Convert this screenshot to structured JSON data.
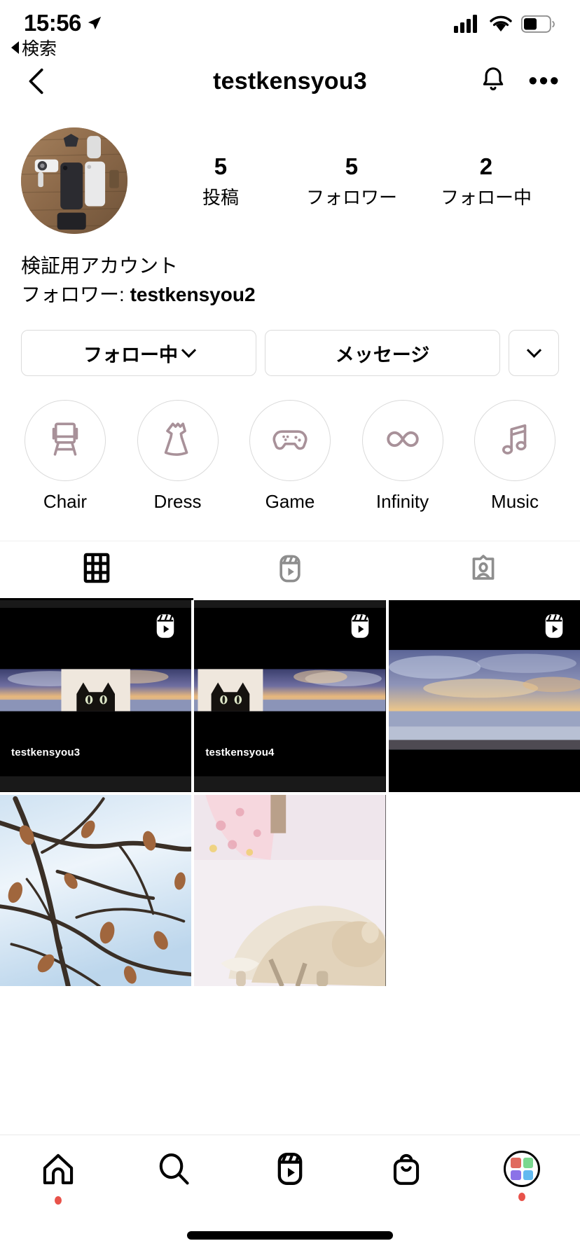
{
  "status_bar": {
    "time": "15:56",
    "location_icon": "location-arrow-icon",
    "back_label": "検索",
    "signal_icon": "cellular-signal-icon",
    "wifi_icon": "wifi-icon",
    "battery_icon": "battery-icon"
  },
  "nav": {
    "back_icon": "chevron-left-icon",
    "title": "testkensyou3",
    "bell_icon": "bell-icon",
    "more_label": "•••"
  },
  "profile": {
    "avatar_icon": "profile-avatar-desk-flatlay",
    "stats": [
      {
        "value": "5",
        "label": "投稿",
        "name": "posts"
      },
      {
        "value": "5",
        "label": "フォロワー",
        "name": "followers"
      },
      {
        "value": "2",
        "label": "フォロー中",
        "name": "following"
      }
    ],
    "bio_name": "検証用アカウント",
    "bio_prefix": "フォロワー: ",
    "bio_username": "testkensyou2"
  },
  "actions": {
    "follow_label": "フォロー中",
    "message_label": "メッセージ",
    "more_icon": "chevron-down-icon"
  },
  "highlights": [
    {
      "label": "Chair",
      "icon": "chair-icon"
    },
    {
      "label": "Dress",
      "icon": "dress-icon"
    },
    {
      "label": "Game",
      "icon": "gamepad-icon"
    },
    {
      "label": "Infinity",
      "icon": "infinity-icon"
    },
    {
      "label": "Music",
      "icon": "music-note-icon"
    }
  ],
  "tabs": [
    {
      "name": "grid",
      "icon": "grid-icon",
      "active": true
    },
    {
      "name": "reels",
      "icon": "reels-icon",
      "active": false
    },
    {
      "name": "tagged",
      "icon": "tagged-icon",
      "active": false
    }
  ],
  "posts": [
    {
      "type": "reel",
      "badge": "reels-icon",
      "overlay_user": "testkensyou3",
      "art": "sunset-sea-cat"
    },
    {
      "type": "reel",
      "badge": "reels-icon",
      "overlay_user": "testkensyou4",
      "art": "cat-sunset-sea"
    },
    {
      "type": "reel",
      "badge": "reels-icon",
      "overlay_user": "",
      "art": "sunset-sea"
    },
    {
      "type": "photo",
      "badge": "",
      "overlay_user": "",
      "art": "winter-branches"
    },
    {
      "type": "photo",
      "badge": "",
      "overlay_user": "",
      "art": "sleeping-cat"
    }
  ],
  "bottom_nav": [
    {
      "name": "home",
      "icon": "home-icon",
      "dot": true
    },
    {
      "name": "search",
      "icon": "search-icon",
      "dot": false
    },
    {
      "name": "reels",
      "icon": "reels-icon",
      "dot": false
    },
    {
      "name": "shop",
      "icon": "shop-bag-icon",
      "dot": false
    },
    {
      "name": "profile",
      "icon": "profile-avatar-icon",
      "dot": true
    }
  ],
  "colors": {
    "accent_dot": "#e8524a",
    "border": "#dbdbdb",
    "highlight_icon": "#a89199",
    "tab_inactive": "#8e8e8e",
    "avatar_red": "#e06a5e",
    "avatar_green": "#7bd88f",
    "avatar_purple": "#8b72e8",
    "avatar_blue": "#62b9f0"
  }
}
